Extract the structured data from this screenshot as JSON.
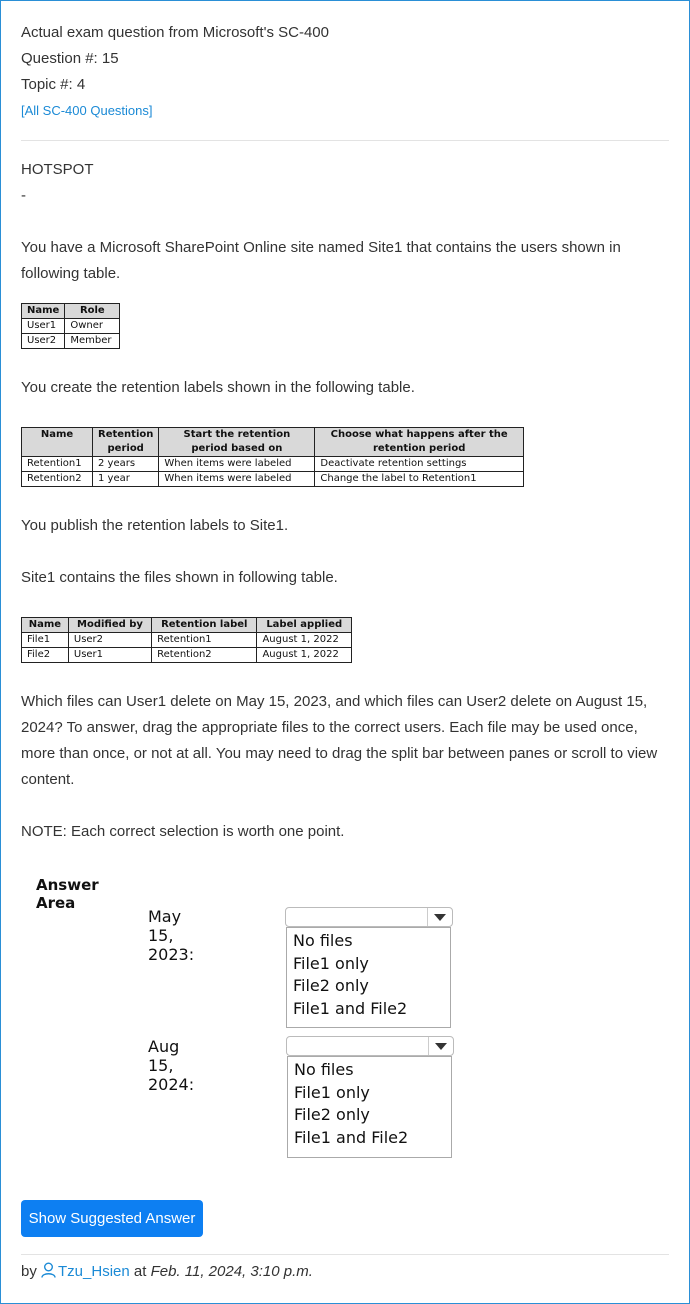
{
  "header": {
    "title": "Actual exam question from Microsoft's SC-400",
    "question": "Question #: 15",
    "topic": "Topic #: 4",
    "all_link": "[All SC-400 Questions]"
  },
  "body": {
    "type_label": "HOTSPOT",
    "dash": "-",
    "intro": "You have a Microsoft SharePoint Online site named Site1 that contains the users shown in following table.",
    "retention_intro": "You create the retention labels shown in the following table.",
    "publish": "You publish the retention labels to Site1.",
    "files_intro": "Site1 contains the files shown in following table.",
    "question_text": "Which files can User1 delete on May 15, 2023, and which files can User2 delete on August 15, 2024? To answer, drag the appropriate files to the correct users. Each file may be used once, more than once, or not at all. You may need to drag the split bar between panes or scroll to view content.",
    "note": "NOTE: Each correct selection is worth one point."
  },
  "users_table": {
    "headers": [
      "Name",
      "Role"
    ],
    "rows": [
      [
        "User1",
        "Owner"
      ],
      [
        "User2",
        "Member"
      ]
    ]
  },
  "retention_table": {
    "headers": [
      "Name",
      "Retention period",
      "Start the retention period based on",
      "Choose what happens after the retention period"
    ],
    "rows": [
      [
        "Retention1",
        "2 years",
        "When items were labeled",
        "Deactivate retention settings"
      ],
      [
        "Retention2",
        "1 year",
        "When items were labeled",
        "Change the label to Retention1"
      ]
    ]
  },
  "files_table": {
    "headers": [
      "Name",
      "Modified by",
      "Retention label",
      "Label applied"
    ],
    "rows": [
      [
        "File1",
        "User2",
        "Retention1",
        "August 1, 2022"
      ],
      [
        "File2",
        "User1",
        "Retention2",
        "August 1, 2022"
      ]
    ]
  },
  "answer_area": {
    "title": "Answer Area",
    "items": [
      {
        "label": "May 15, 2023:",
        "selected": "",
        "options": [
          "No files",
          "File1 only",
          "File2 only",
          "File1 and File2"
        ]
      },
      {
        "label": "Aug 15, 2024:",
        "selected": "",
        "options": [
          "No files",
          "File1 only",
          "File2 only",
          "File1 and File2"
        ]
      }
    ]
  },
  "actions": {
    "show_answer": "Show Suggested Answer"
  },
  "footer": {
    "by": "by",
    "user": "Tzu_Hsien",
    "at": "at",
    "date": "Feb. 11, 2024, 3:10 p.m."
  },
  "colors": {
    "link": "#1b8ad6",
    "button": "#0d7ff2",
    "border": "#2a8fd6"
  }
}
